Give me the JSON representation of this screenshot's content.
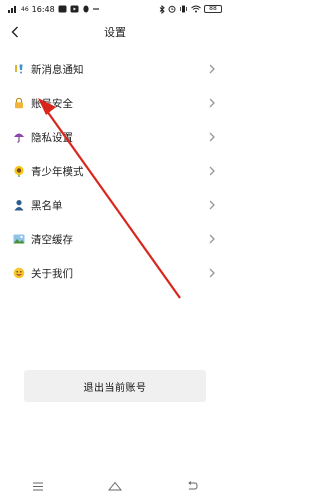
{
  "status_bar": {
    "signal": "46",
    "time": "16:48",
    "battery": "88"
  },
  "header": {
    "title": "设置"
  },
  "menu": {
    "items": [
      {
        "label": "新消息通知",
        "icon": "bell-icon"
      },
      {
        "label": "账号安全",
        "icon": "lock-icon"
      },
      {
        "label": "隐私设置",
        "icon": "umbrella-icon"
      },
      {
        "label": "青少年模式",
        "icon": "sunflower-icon"
      },
      {
        "label": "黑名单",
        "icon": "person-icon"
      },
      {
        "label": "清空缓存",
        "icon": "image-icon"
      },
      {
        "label": "关于我们",
        "icon": "smile-icon"
      }
    ]
  },
  "logout": {
    "label": "退出当前账号"
  },
  "colors": {
    "annotation_arrow": "#d9261c",
    "button_bg": "#f0f0f0"
  }
}
